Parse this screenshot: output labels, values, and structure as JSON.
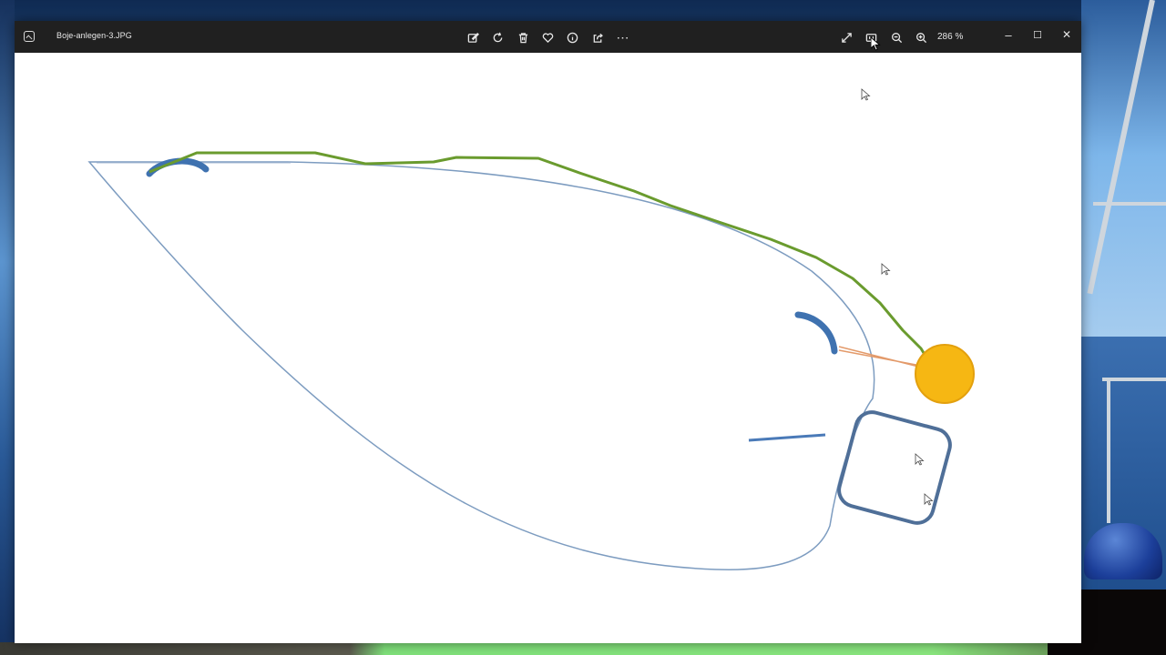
{
  "window": {
    "file_name": "Boje-anlegen-3.JPG",
    "zoom_level": "286 %"
  },
  "toolbar": {
    "edit": "edit-image",
    "rotate": "rotate",
    "delete": "delete",
    "favorite": "favorite",
    "info": "file-info",
    "share": "share",
    "more": "⋯",
    "fullscreen": "fullscreen",
    "fit": "fit-to-window",
    "zoom_out": "zoom-out",
    "zoom_in": "zoom-in"
  },
  "window_controls": {
    "minimize": "–",
    "maximize": "☐",
    "close": "✕"
  },
  "image": {
    "boat_outline_color": "#7d9cc0",
    "fender_color": "#3f72b0",
    "line_color": "#6a9b2e",
    "buoy_color": "#f6b713",
    "buoy_outline": "#e3a00e",
    "rope_color": "#e39a6a",
    "square_color": "#4f6f98"
  }
}
